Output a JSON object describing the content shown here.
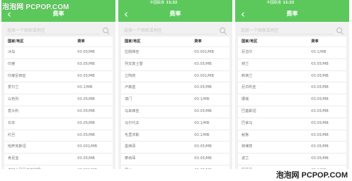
{
  "watermark_top": "泡泡网 PCPOP.COM",
  "watermark_bottom": "泡泡网 PCPOP.COM",
  "screens": [
    {
      "status": {
        "carrier": "",
        "time": "",
        "right": ""
      },
      "title": "费率",
      "back_icon": "‹",
      "search_placeholder": "选择一个国家或地区",
      "col_country": "国家/地区",
      "col_rate": "费率",
      "rows": [
        {
          "country": "冰岛",
          "rate": "€0.05/MB"
        },
        {
          "country": "印度",
          "rate": "€0.05/MB"
        },
        {
          "country": "印度尼西亚",
          "rate": "€0.05/MB"
        },
        {
          "country": "爱尔兰",
          "rate": "€0.1/MB"
        },
        {
          "country": "以色列",
          "rate": "€0.05/MB"
        },
        {
          "country": "意大利",
          "rate": "€0.05/MB"
        },
        {
          "country": "日本",
          "rate": "€0.05/MB"
        },
        {
          "country": "约旦",
          "rate": "€0.05/MB"
        },
        {
          "country": "哈萨克斯坦",
          "rate": "€0.001/MB"
        },
        {
          "country": "肯尼亚",
          "rate": "€0.05/MB"
        },
        {
          "country": "老挝人民民主共和国",
          "rate": "€0.001/MB"
        }
      ]
    },
    {
      "status": {
        "carrier": "中国联通",
        "time": "11:22",
        "right": ""
      },
      "title": "费率",
      "back_icon": "‹",
      "search_placeholder": "选择一个国家或地区",
      "col_country": "国家/地区",
      "col_rate": "费率",
      "rows": [
        {
          "country": "拉脱维亚",
          "rate": "€0.001/MB"
        },
        {
          "country": "列支敦士登",
          "rate": "€0.05/MB"
        },
        {
          "country": "立陶宛",
          "rate": "€0.001/MB"
        },
        {
          "country": "卢森堡",
          "rate": "€0.05/MB"
        },
        {
          "country": "澳门",
          "rate": "€0.1/MB"
        },
        {
          "country": "马来西亚",
          "rate": "€0.05/MB"
        },
        {
          "country": "马尔代夫",
          "rate": "€0.1/MB"
        },
        {
          "country": "毛里求斯",
          "rate": "€0.1/MB"
        },
        {
          "country": "墨西哥",
          "rate": "€0.05/MB"
        },
        {
          "country": "摩纳哥",
          "rate": "€0.05/MB"
        },
        {
          "country": "黑山",
          "rate": "€0.05/MB"
        }
      ]
    },
    {
      "status": {
        "carrier": "中国联通",
        "time": "11:22",
        "right": ""
      },
      "title": "费率",
      "back_icon": "‹",
      "search_placeholder": "选择一个国家或地区",
      "col_country": "国家/地区",
      "col_rate": "费率",
      "rows": [
        {
          "country": "尼泊尔",
          "rate": "€0.1/MB"
        },
        {
          "country": "荷兰",
          "rate": "€0.05/MB"
        },
        {
          "country": "新西兰",
          "rate": "€0.05/MB"
        },
        {
          "country": "尼日利亚",
          "rate": "€0.05/MB"
        },
        {
          "country": "挪威",
          "rate": "€0.05/MB"
        },
        {
          "country": "巴基斯坦",
          "rate": "€0.05/MB"
        },
        {
          "country": "巴拿马",
          "rate": "€0.05/MB"
        },
        {
          "country": "秘鲁",
          "rate": "€0.05/MB"
        },
        {
          "country": "菲律宾",
          "rate": "€0.05/MB"
        },
        {
          "country": "波兰",
          "rate": "€0.05/MB"
        },
        {
          "country": "葡萄牙",
          "rate": "€0.1/MB"
        }
      ]
    }
  ]
}
